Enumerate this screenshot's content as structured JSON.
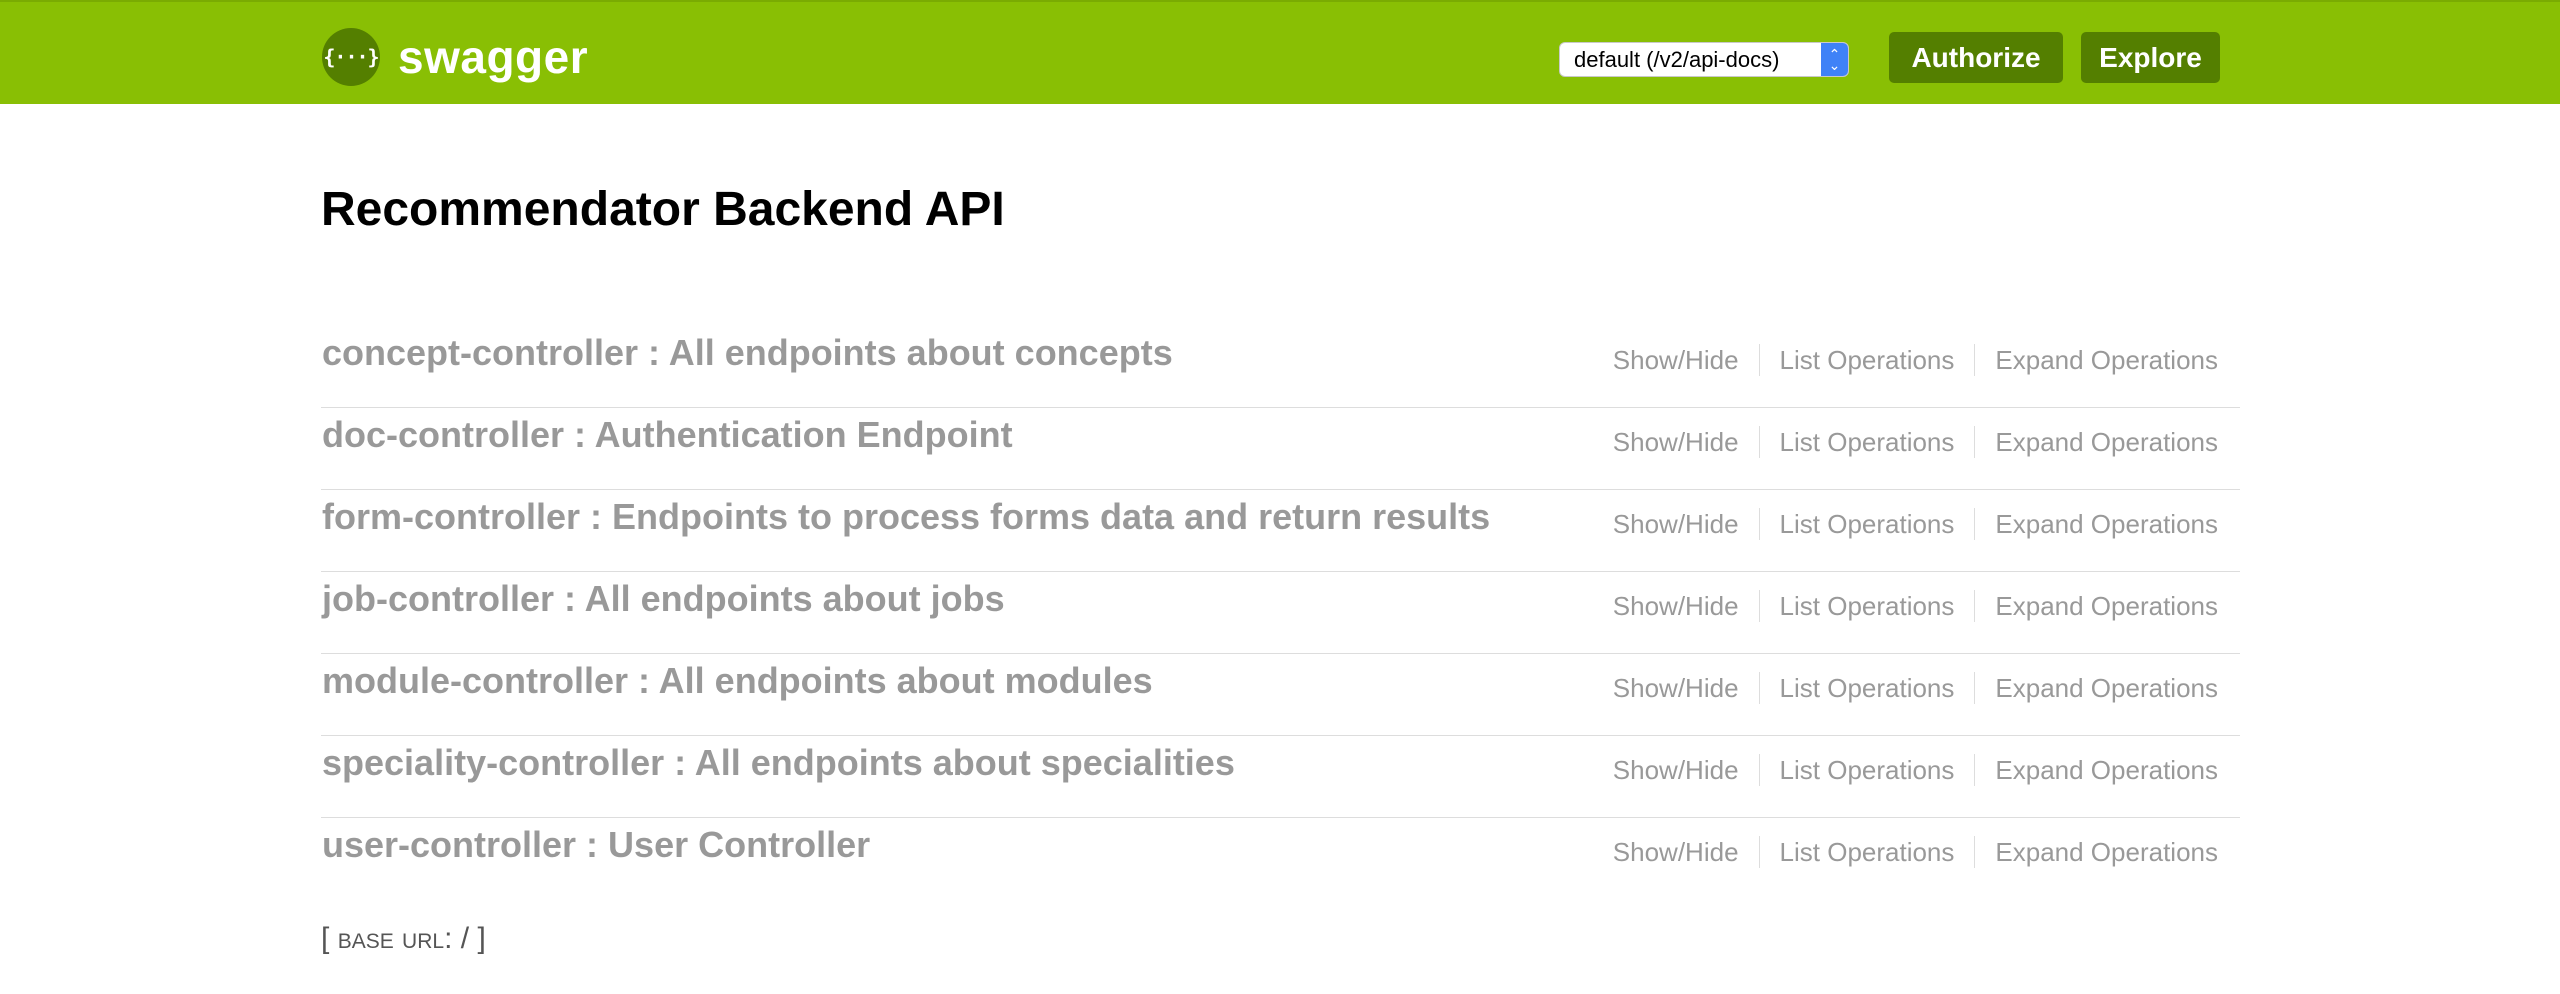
{
  "header": {
    "logo_symbol": "{···}",
    "logo_text": "swagger",
    "spec_selector": {
      "selected": "default (/v2/api-docs)"
    },
    "authorize_label": "Authorize",
    "explore_label": "Explore",
    "colors": {
      "background": "#89bf04",
      "button": "#547f00",
      "select_arrow": "#3f82f7"
    }
  },
  "api": {
    "title": "Recommendator Backend API"
  },
  "resources": [
    {
      "heading": "concept-controller : All endpoints about concepts",
      "show_hide": "Show/Hide",
      "list_ops": "List Operations",
      "expand_ops": "Expand Operations"
    },
    {
      "heading": "doc-controller : Authentication Endpoint",
      "show_hide": "Show/Hide",
      "list_ops": "List Operations",
      "expand_ops": "Expand Operations"
    },
    {
      "heading": "form-controller : Endpoints to process forms data and return results",
      "show_hide": "Show/Hide",
      "list_ops": "List Operations",
      "expand_ops": "Expand Operations"
    },
    {
      "heading": "job-controller : All endpoints about jobs",
      "show_hide": "Show/Hide",
      "list_ops": "List Operations",
      "expand_ops": "Expand Operations"
    },
    {
      "heading": "module-controller : All endpoints about modules",
      "show_hide": "Show/Hide",
      "list_ops": "List Operations",
      "expand_ops": "Expand Operations"
    },
    {
      "heading": "speciality-controller : All endpoints about specialities",
      "show_hide": "Show/Hide",
      "list_ops": "List Operations",
      "expand_ops": "Expand Operations"
    },
    {
      "heading": "user-controller : User Controller",
      "show_hide": "Show/Hide",
      "list_ops": "List Operations",
      "expand_ops": "Expand Operations"
    }
  ],
  "footer": {
    "open_bracket": "[",
    "base_url_label": "base url",
    "separator": ":",
    "base_url_value": "/",
    "close_bracket": "]"
  }
}
